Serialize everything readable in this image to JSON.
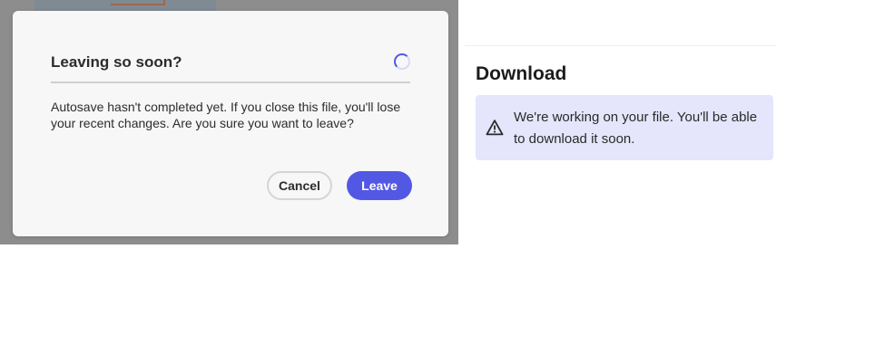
{
  "dialog": {
    "title": "Leaving so soon?",
    "spinner_icon": "loading-spinner-icon",
    "body": "Autosave hasn't completed yet. If you close this file, you'll lose your recent changes. Are you sure you want to leave?",
    "cancel_label": "Cancel",
    "leave_label": "Leave"
  },
  "panel": {
    "heading": "Download",
    "notice": {
      "icon": "warning-icon",
      "text": "We're working on your file. You'll be able to download it soon."
    }
  },
  "colors": {
    "accent": "#5258e4",
    "notice_bg": "#e5e5fc",
    "backdrop": "#8d8d8d"
  }
}
